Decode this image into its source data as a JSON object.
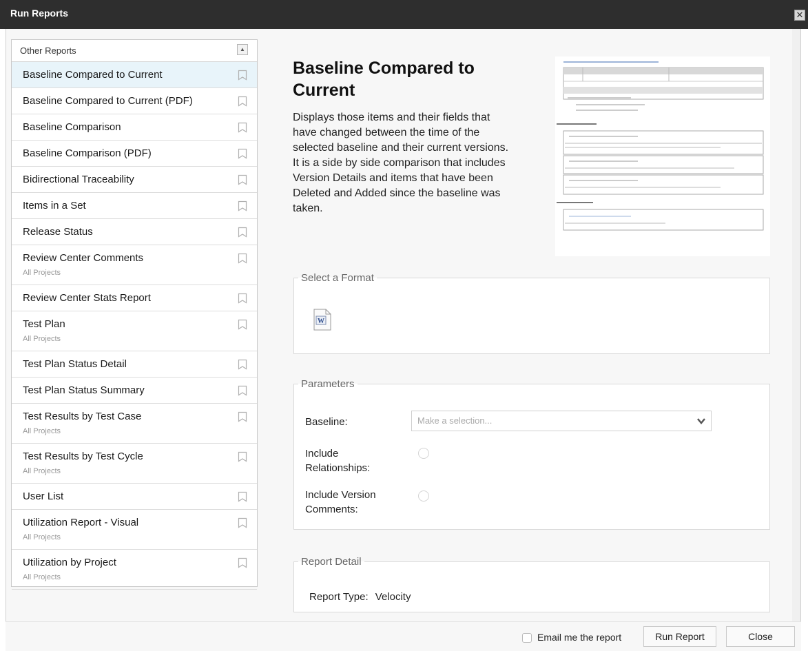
{
  "window": {
    "title": "Run Reports",
    "close_glyph": "✕"
  },
  "sidebar": {
    "header": "Other Reports",
    "items": [
      {
        "label": "Baseline Compared to Current",
        "sub": "",
        "selected": true
      },
      {
        "label": "Baseline Compared to Current (PDF)",
        "sub": ""
      },
      {
        "label": "Baseline Comparison",
        "sub": ""
      },
      {
        "label": "Baseline Comparison (PDF)",
        "sub": ""
      },
      {
        "label": "Bidirectional Traceability",
        "sub": ""
      },
      {
        "label": "Items in a Set",
        "sub": ""
      },
      {
        "label": "Release Status",
        "sub": ""
      },
      {
        "label": "Review Center Comments",
        "sub": "All Projects"
      },
      {
        "label": "Review Center Stats Report",
        "sub": ""
      },
      {
        "label": "Test Plan",
        "sub": "All Projects"
      },
      {
        "label": "Test Plan Status Detail",
        "sub": ""
      },
      {
        "label": "Test Plan Status Summary",
        "sub": ""
      },
      {
        "label": "Test Results by Test Case",
        "sub": "All Projects"
      },
      {
        "label": "Test Results by Test Cycle",
        "sub": "All Projects"
      },
      {
        "label": "User List",
        "sub": ""
      },
      {
        "label": "Utilization Report - Visual",
        "sub": "All Projects"
      },
      {
        "label": "Utilization by Project",
        "sub": "All Projects"
      }
    ]
  },
  "report": {
    "title": "Baseline Compared to Current",
    "description": "Displays those items and their fields that have changed between the time of the selected baseline and their current versions. It is a side by side comparison that includes Version Details and items that have been Deleted and Added since the baseline was taken."
  },
  "format": {
    "legend": "Select a Format",
    "icon": "word-document-icon"
  },
  "parameters": {
    "legend": "Parameters",
    "baseline_label": "Baseline:",
    "baseline_placeholder": "Make a selection...",
    "include_relationships_label": "Include Relationships:",
    "include_version_comments_label": "Include Version Comments:"
  },
  "detail": {
    "legend": "Report Detail",
    "report_type_label": "Report Type:",
    "report_type_value": "Velocity"
  },
  "footer": {
    "email_label": "Email me the report",
    "run_label": "Run Report",
    "close_label": "Close"
  },
  "colors": {
    "titlebar": "#2e2e2e",
    "selected_row": "#e8f4fa"
  }
}
